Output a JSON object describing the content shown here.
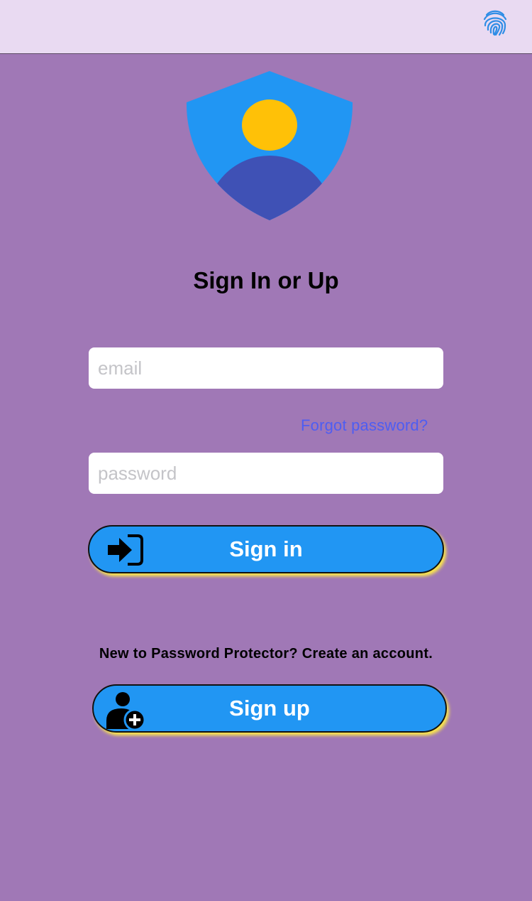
{
  "header": {
    "icon": "fingerprint-icon"
  },
  "logo": {
    "icon": "user-shield-icon",
    "colors": {
      "shield": "#2196f3",
      "head": "#ffc107",
      "body": "#3f51b5"
    }
  },
  "title": "Sign In or Up",
  "form": {
    "email_placeholder": "email",
    "forgot_label": "Forgot password?",
    "password_placeholder": "password"
  },
  "signin_button": {
    "label": "Sign in",
    "icon": "sign-in-icon"
  },
  "signup_prompt": "New to Password Protector? Create an account.",
  "signup_button": {
    "label": "Sign up",
    "icon": "user-plus-icon"
  },
  "colors": {
    "background": "#a078b6",
    "header": "#e9daf2",
    "button": "#2196f3",
    "button_glow": "#ffec46",
    "link": "#4e5df2"
  }
}
